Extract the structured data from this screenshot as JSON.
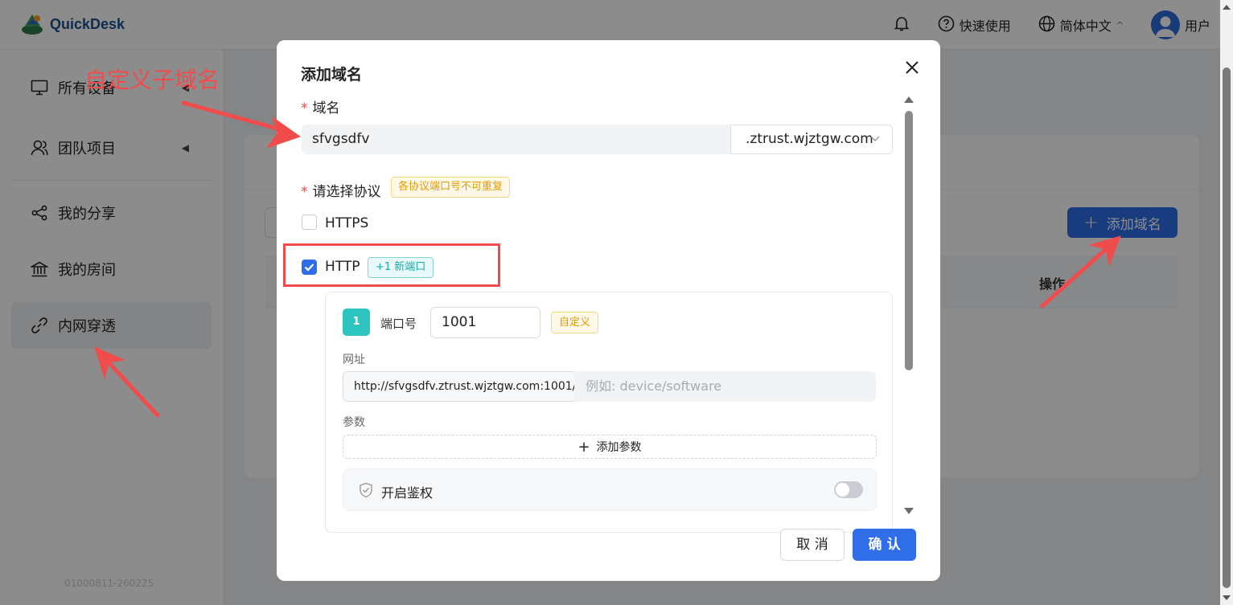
{
  "app": {
    "name": "QuickDesk",
    "quick_start": "快速使用",
    "language": "简体中文",
    "user": "用户"
  },
  "sidebar": {
    "items": [
      {
        "label": "所有设备"
      },
      {
        "label": "团队项目"
      },
      {
        "label": "我的分享"
      },
      {
        "label": "我的房间"
      },
      {
        "label": "内网穿透"
      }
    ],
    "version": "01000811-260225"
  },
  "main": {
    "add_domain_button": "添加域名",
    "column_action": "操作"
  },
  "modal": {
    "title": "添加域名",
    "domain_label": "域名",
    "domain_value": "sfvgsdfv",
    "domain_suffix": ".ztrust.wjztgw.com",
    "protocol_label": "请选择协议",
    "protocol_hint": "各协议端口号不可重复",
    "https_label": "HTTPS",
    "http_label": "HTTP",
    "new_port_tag": "+1 新端口",
    "port": {
      "index": "1",
      "label": "端口号",
      "value": "1001",
      "custom_tag": "自定义",
      "url_label": "网址",
      "url_prefix": "http://sfvgsdfv.ztrust.wjztgw.com:1001/",
      "url_placeholder": "例如: device/software",
      "params_label": "参数",
      "add_param": "添加参数",
      "auth_label": "开启鉴权"
    },
    "cancel": "取 消",
    "confirm": "确 认"
  },
  "annotation": {
    "text": "自定义子域名"
  },
  "colors": {
    "primary": "#2f6ee8",
    "annotation": "#f04c4c",
    "teal": "#2ec4c0",
    "warning": "#e39b00"
  }
}
